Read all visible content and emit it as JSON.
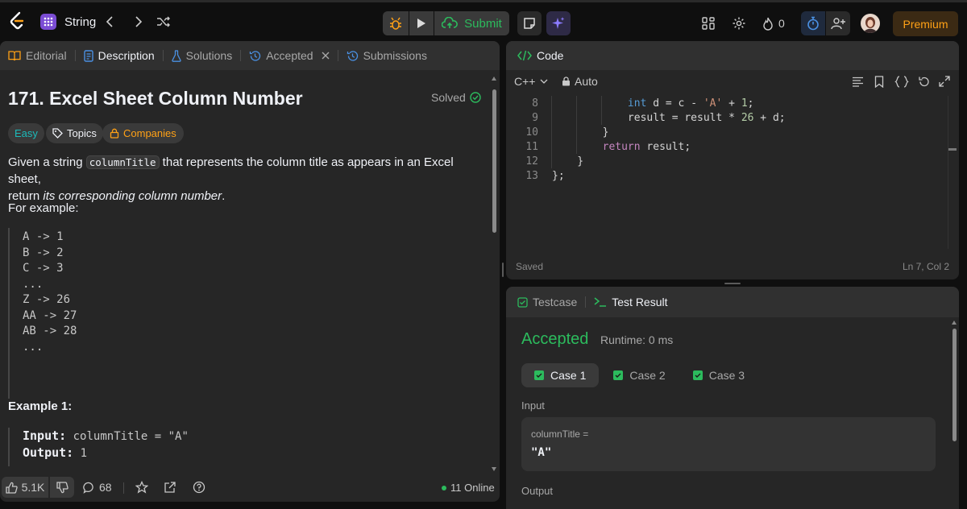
{
  "topbar": {
    "problem_list_label": "String",
    "submit_label": "Submit",
    "streak_count": "0",
    "premium_label": "Premium"
  },
  "left": {
    "tabs": [
      {
        "label": "Editorial"
      },
      {
        "label": "Description"
      },
      {
        "label": "Solutions"
      },
      {
        "label": "Accepted"
      },
      {
        "label": "Submissions"
      }
    ],
    "title": "171. Excel Sheet Column Number",
    "solved_label": "Solved",
    "tags": {
      "difficulty": "Easy",
      "topics": "Topics",
      "companies": "Companies"
    },
    "desc_prefix": "Given a string ",
    "desc_code": "columnTitle",
    "desc_mid": " that represents the column title as appears in an Excel sheet,",
    "desc_line2a": "return ",
    "desc_line2b": "its corresponding column number",
    "desc_line2c": ".",
    "for_example": "For example:",
    "example_lines": [
      "A -> 1",
      "B -> 2",
      "C -> 3",
      "...",
      "Z -> 26",
      "AA -> 27",
      "AB -> 28",
      "..."
    ],
    "example1_heading": "Example 1:",
    "example1_input_label": "Input:",
    "example1_input_value": " columnTitle = \"A\"",
    "example1_output_label": "Output:",
    "example1_output_value": " 1",
    "footer": {
      "likes": "5.1K",
      "comments": "68",
      "online": "11 Online"
    }
  },
  "code": {
    "tab_label": "Code",
    "language": "C++",
    "auto_label": "Auto",
    "lines": [
      {
        "n": "8",
        "text": "            int d = c - 'A' + 1;"
      },
      {
        "n": "9",
        "text": "            result = result * 26 + d;"
      },
      {
        "n": "10",
        "text": "        }"
      },
      {
        "n": "11",
        "text": "        return result;"
      },
      {
        "n": "12",
        "text": "    }"
      },
      {
        "n": "13",
        "text": "};"
      }
    ],
    "status_saved": "Saved",
    "cursor_pos": "Ln 7, Col 2"
  },
  "test": {
    "tab_testcase": "Testcase",
    "tab_result": "Test Result",
    "status": "Accepted",
    "runtime": "Runtime: 0 ms",
    "cases": [
      "Case 1",
      "Case 2",
      "Case 3"
    ],
    "input_label": "Input",
    "param_name": "columnTitle =",
    "param_value": "\"A\"",
    "output_label": "Output"
  },
  "colors": {
    "accent_green": "#2cbb5d",
    "easy": "#1cbaba",
    "companies": "#ffa116",
    "premium": "#ffa116",
    "link_blue": "#4a90e2"
  }
}
